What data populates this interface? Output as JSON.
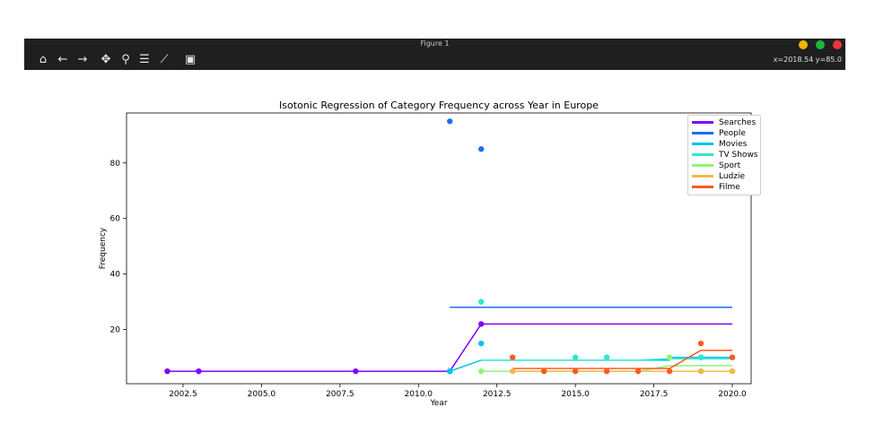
{
  "window": {
    "title": "Figure 1",
    "coords": "x=2018.54 y=85.0",
    "buttons": [
      {
        "name": "minimize",
        "color": "#f5b400"
      },
      {
        "name": "maximize",
        "color": "#1db83a"
      },
      {
        "name": "close",
        "color": "#f0353b"
      }
    ]
  },
  "toolbar": {
    "icons": [
      "home-icon",
      "back-icon",
      "forward-icon",
      "pan-icon",
      "zoom-icon",
      "configure-subplots-icon",
      "edit-axis-icon",
      "save-icon"
    ],
    "glyphs": [
      "⌂",
      "←",
      "→",
      "✥",
      "⚲",
      "☰",
      "⟋",
      "▣"
    ]
  },
  "chart_data": {
    "type": "line",
    "title": "Isotonic Regression of Category Frequency across Year in Europe",
    "xlabel": "Year",
    "ylabel": "Frequency",
    "xlim": [
      2000.7,
      2020.6
    ],
    "ylim": [
      0.5,
      98
    ],
    "xticks": [
      2002.5,
      2005.0,
      2007.5,
      2010.0,
      2012.5,
      2015.0,
      2017.5,
      2020.0
    ],
    "xtick_labels": [
      "2002.5",
      "2005.0",
      "2007.5",
      "2010.0",
      "2012.5",
      "2015.0",
      "2017.5",
      "2020.0"
    ],
    "yticks": [
      20,
      40,
      60,
      80
    ],
    "ytick_labels": [
      "20",
      "40",
      "60",
      "80"
    ],
    "legend_position": "top-right",
    "grid": false,
    "series": [
      {
        "name": "Searches",
        "color": "#8000ff",
        "points": [
          [
            2002,
            5
          ],
          [
            2003,
            5
          ],
          [
            2008,
            5
          ],
          [
            2011,
            5
          ],
          [
            2012,
            22
          ]
        ],
        "fit": [
          [
            2002,
            5
          ],
          [
            2003,
            5
          ],
          [
            2008,
            5
          ],
          [
            2011,
            5
          ],
          [
            2012,
            22
          ],
          [
            2020,
            22
          ]
        ]
      },
      {
        "name": "People",
        "color": "#1e6df5",
        "points": [
          [
            2011,
            95
          ],
          [
            2012,
            85
          ]
        ],
        "fit": [
          [
            2011,
            28
          ],
          [
            2020,
            28
          ]
        ]
      },
      {
        "name": "Movies",
        "color": "#00c4e6",
        "points": [
          [
            2011,
            5
          ],
          [
            2012,
            15
          ],
          [
            2019,
            10
          ]
        ],
        "fit": [
          [
            2011,
            5
          ],
          [
            2012,
            9
          ],
          [
            2018,
            9
          ],
          [
            2018,
            10
          ],
          [
            2020,
            10
          ]
        ]
      },
      {
        "name": "TV Shows",
        "color": "#2ee6cf",
        "points": [
          [
            2012,
            30
          ],
          [
            2015,
            10
          ],
          [
            2016,
            10
          ],
          [
            2019,
            10
          ]
        ],
        "fit": [
          [
            2012,
            9
          ],
          [
            2017,
            9
          ],
          [
            2018,
            9.5
          ],
          [
            2020,
            9.5
          ]
        ]
      },
      {
        "name": "Sport",
        "color": "#8cf57a",
        "points": [
          [
            2012,
            5
          ],
          [
            2018,
            10
          ],
          [
            2019,
            5
          ],
          [
            2020,
            5
          ]
        ],
        "fit": [
          [
            2012,
            5
          ],
          [
            2017,
            5
          ],
          [
            2018,
            7
          ],
          [
            2020,
            7
          ]
        ]
      },
      {
        "name": "Ludzie",
        "color": "#f5b84a",
        "points": [
          [
            2013,
            5
          ],
          [
            2019,
            5
          ],
          [
            2020,
            5
          ]
        ],
        "fit": [
          [
            2013,
            5
          ],
          [
            2020,
            5
          ]
        ]
      },
      {
        "name": "Filme",
        "color": "#ff5a1e",
        "points": [
          [
            2013,
            10
          ],
          [
            2014,
            5
          ],
          [
            2015,
            5
          ],
          [
            2016,
            5
          ],
          [
            2017,
            5
          ],
          [
            2018,
            5
          ],
          [
            2019,
            15
          ],
          [
            2020,
            10
          ]
        ],
        "fit": [
          [
            2013,
            6
          ],
          [
            2018,
            6
          ],
          [
            2019,
            12.5
          ],
          [
            2020,
            12.5
          ]
        ]
      }
    ]
  }
}
